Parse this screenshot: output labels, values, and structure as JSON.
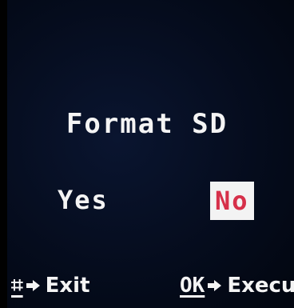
{
  "dialog": {
    "title": "Format SD",
    "options": {
      "yes_label": "Yes",
      "no_label": "No",
      "selected": "No"
    }
  },
  "footer": {
    "exit": {
      "key_icon": "menu-gear-icon",
      "key_glyph": "⌗",
      "arrow_icon": "arrow-right-icon",
      "label": "Exit"
    },
    "execute": {
      "key_label": "OK",
      "arrow_icon": "arrow-right-icon",
      "label": "Execu"
    }
  },
  "colors": {
    "background": "#050c1d",
    "text": "#f4f4f4",
    "selected_background": "#f3f3f3",
    "selected_text": "#d6304a"
  }
}
